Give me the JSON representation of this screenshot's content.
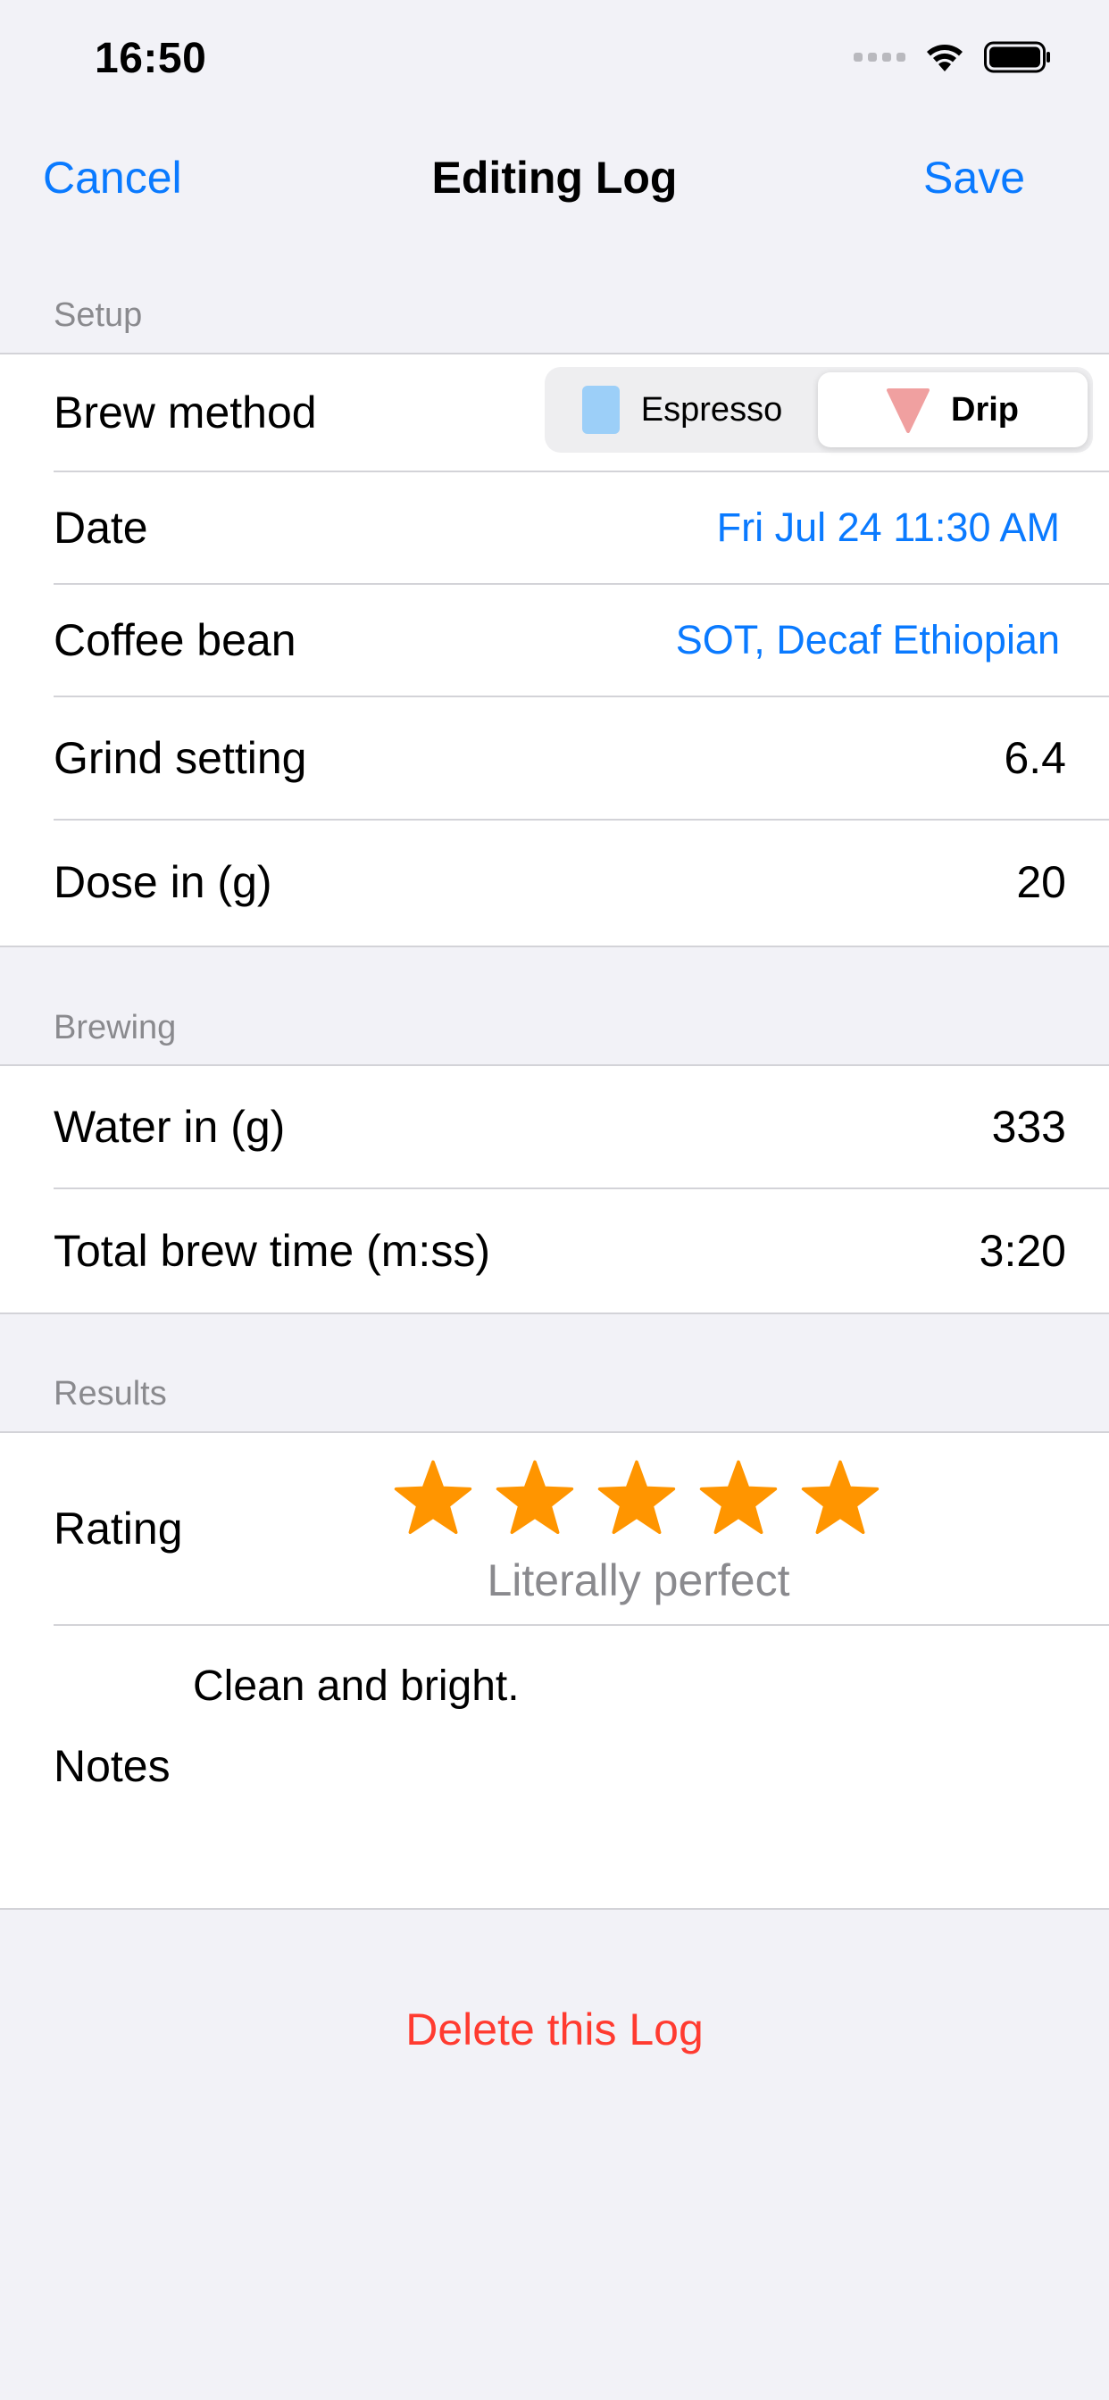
{
  "status_bar": {
    "time": "16:50"
  },
  "nav": {
    "cancel_label": "Cancel",
    "title": "Editing Log",
    "save_label": "Save"
  },
  "sections": {
    "setup": "Setup",
    "brewing": "Brewing",
    "results": "Results"
  },
  "setup": {
    "brew_method_label": "Brew method",
    "brew_method_options": [
      "Espresso",
      "Drip"
    ],
    "brew_method_selected": "Drip",
    "date_label": "Date",
    "date_value": "Fri Jul 24 11:30 AM",
    "bean_label": "Coffee bean",
    "bean_value": "SOT, Decaf Ethiopian",
    "grind_label": "Grind setting",
    "grind_value": "6.4",
    "dose_label": "Dose in (g)",
    "dose_value": "20"
  },
  "brewing": {
    "water_label": "Water in (g)",
    "water_value": "333",
    "time_label": "Total brew time (m:ss)",
    "time_value": "3:20"
  },
  "results": {
    "rating_label": "Rating",
    "rating_stars": 5,
    "rating_max": 5,
    "rating_caption": "Literally perfect",
    "notes_label": "Notes",
    "notes_text": "Clean and bright."
  },
  "actions": {
    "delete_label": "Delete this Log"
  },
  "colors": {
    "accent": "#0a7aff",
    "destructive": "#ff3b30",
    "star": "#ff9500",
    "espresso_icon": "#9ccff8",
    "drip_icon": "#f0a0a0"
  },
  "icons": {
    "espresso": "square-icon",
    "drip": "triangle-icon",
    "star": "star-icon"
  }
}
